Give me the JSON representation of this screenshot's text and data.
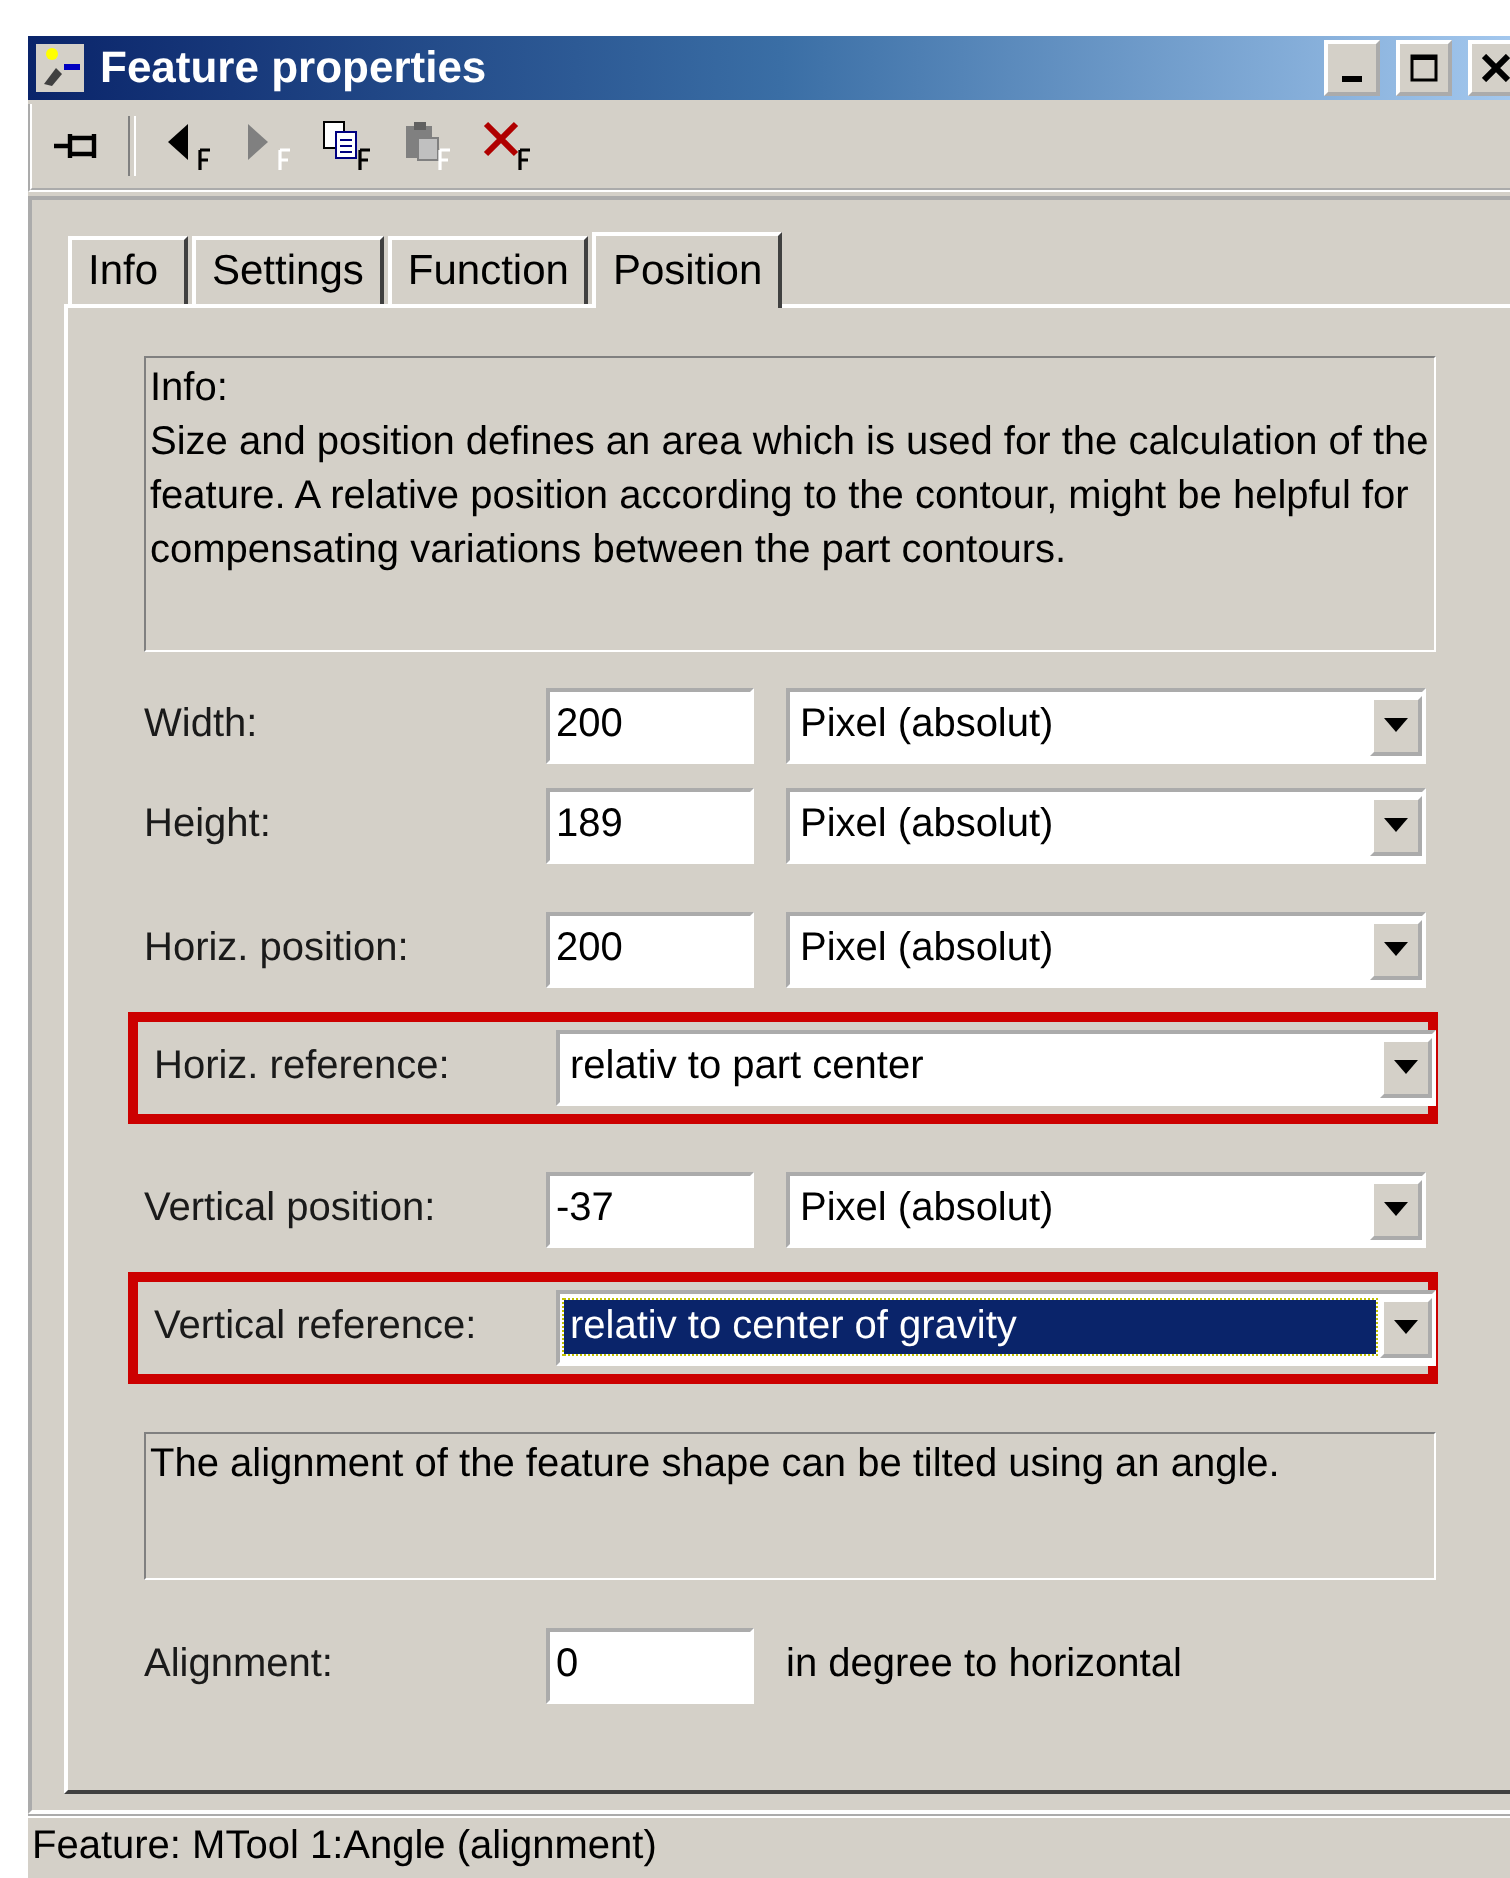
{
  "window": {
    "title": "Feature properties"
  },
  "toolbar": [
    {
      "kind": "pin",
      "disabled": false
    },
    {
      "kind": "previous",
      "disabled": false
    },
    {
      "kind": "next",
      "disabled": true
    },
    {
      "kind": "copy",
      "disabled": false
    },
    {
      "kind": "paste",
      "disabled": true
    },
    {
      "kind": "delete",
      "disabled": false
    }
  ],
  "tabs": [
    {
      "label": "Info",
      "selected": false
    },
    {
      "label": "Settings",
      "selected": false
    },
    {
      "label": "Function",
      "selected": false
    },
    {
      "label": "Position",
      "selected": true
    }
  ],
  "info": {
    "heading": "Info:",
    "text": "Size and position defines an area which is used for the calculation of the feature. A relative position according to the contour, might be helpful for compensating variations between the part contours."
  },
  "groups": [
    [
      {
        "kind": "value_unit",
        "label": "Width:",
        "value": "200",
        "unit": "Pixel (absolut)"
      },
      {
        "kind": "value_unit",
        "label": "Height:",
        "value": "189",
        "unit": "Pixel (absolut)"
      }
    ],
    [
      {
        "kind": "value_unit",
        "label": "Horiz. position:",
        "value": "200",
        "unit": "Pixel (absolut)"
      },
      {
        "kind": "choice",
        "label": "Horiz. reference:",
        "choice": "relativ to part center",
        "highlighted": true,
        "focused": false
      }
    ],
    [
      {
        "kind": "value_unit",
        "label": "Vertical position:",
        "value": "-37",
        "unit": "Pixel (absolut)"
      },
      {
        "kind": "choice",
        "label": "Vertical reference:",
        "choice": "relativ to center of gravity",
        "highlighted": true,
        "focused": true
      }
    ]
  ],
  "angle_note": "The alignment of the feature shape can be tilted using an angle.",
  "alignment": {
    "label": "Alignment:",
    "value": "0",
    "unit": "in degree to horizontal"
  },
  "status_bar": "Feature: MTool 1:Angle (alignment)"
}
